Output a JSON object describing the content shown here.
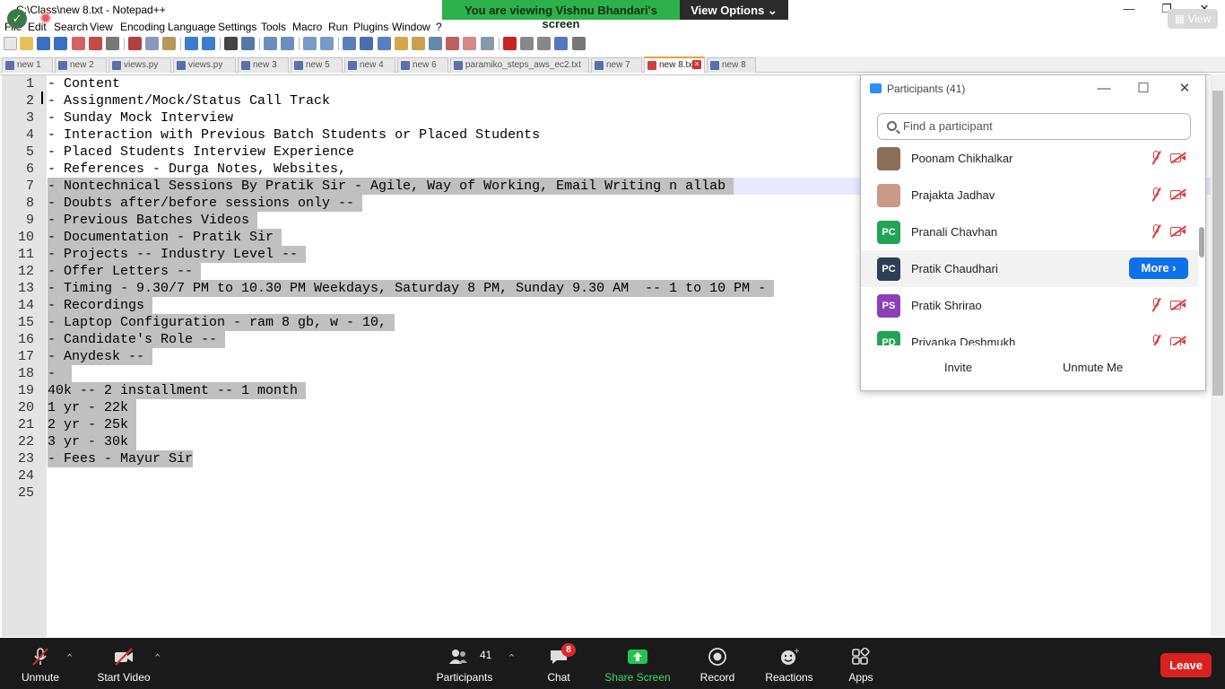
{
  "window": {
    "title": "C:\\Class\\new 8.txt - Notepad++",
    "minimize": "—",
    "restore": "❐",
    "close": "✕"
  },
  "share_banner": {
    "viewing_text": "You are viewing Vishnu Bhandari's screen",
    "view_options": "View Options ⌄"
  },
  "view_pill": "▦ View",
  "menu": [
    "File",
    "Edit",
    "Search",
    "View",
    "Encoding",
    "Language",
    "Settings",
    "Tools",
    "Macro",
    "Run",
    "Plugins",
    "Window",
    "?"
  ],
  "tabs": [
    {
      "label": "new 1"
    },
    {
      "label": "new 2"
    },
    {
      "label": "views.py"
    },
    {
      "label": "views.py"
    },
    {
      "label": "new 3"
    },
    {
      "label": "new 5"
    },
    {
      "label": "new 4"
    },
    {
      "label": "new 6"
    },
    {
      "label": "paramiko_steps_aws_ec2.txt"
    },
    {
      "label": "new 7"
    },
    {
      "label": "new 8.txt",
      "active": true
    },
    {
      "label": "new 8"
    }
  ],
  "editor": {
    "lines": [
      "- Content",
      "- Assignment/Mock/Status Call Track",
      "- Sunday Mock Interview",
      "- Interaction with Previous Batch Students or Placed Students",
      "- Placed Students Interview Experience",
      "- References - Durga Notes, Websites,",
      "- Nontechnical Sessions By Pratik Sir - Agile, Way of Working, Email Writing n allab ",
      "- Doubts after/before sessions only -- ",
      "- Previous Batches Videos ",
      "- Documentation - Pratik Sir ",
      "- Projects -- Industry Level -- ",
      "- Offer Letters -- ",
      "- Timing - 9.30/7 PM to 10.30 PM Weekdays, Saturday 8 PM, Sunday 9.30 AM  -- 1 to 10 PM - ",
      "- Recordings ",
      "- Laptop Configuration - ram 8 gb, w - 10, ",
      "- Candidate's Role -- ",
      "- Anydesk -- ",
      "-  ",
      "40k -- 2 installment -- 1 month ",
      "1 yr - 22k ",
      "2 yr - 25k ",
      "3 yr - 30k ",
      "- Fees - Mayur Sir",
      "",
      ""
    ],
    "line_numbers": [
      "1",
      "2",
      "3",
      "4",
      "5",
      "6",
      "7",
      "8",
      "9",
      "10",
      "11",
      "12",
      "13",
      "14",
      "15",
      "16",
      "17",
      "18",
      "19",
      "20",
      "21",
      "22",
      "23",
      "24",
      "25"
    ]
  },
  "participants_panel": {
    "title": "Participants (41)",
    "search_placeholder": "Find a participant",
    "participants": [
      {
        "name": "Poonam Chikhalkar",
        "initials": "",
        "avatar_color": "#8a6e5a",
        "muted": true,
        "video_off": true
      },
      {
        "name": "Prajakta Jadhav",
        "initials": "",
        "avatar_color": "#c99a88",
        "muted": true,
        "video_off": true
      },
      {
        "name": "Pranali Chavhan",
        "initials": "PC",
        "avatar_color": "#23a455",
        "muted": true,
        "video_off": true
      },
      {
        "name": "Pratik Chaudhari",
        "initials": "PC",
        "avatar_color": "#2e3e55",
        "highlighted": true,
        "more_label": "More ›"
      },
      {
        "name": "Pratik Shrirao",
        "initials": "PS",
        "avatar_color": "#8b3fb8",
        "muted": true,
        "video_off": true
      },
      {
        "name": "Priyanka Deshmukh",
        "initials": "PD",
        "avatar_color": "#23a455",
        "muted": true,
        "video_off": true
      }
    ],
    "invite_label": "Invite",
    "unmute_me_label": "Unmute Me"
  },
  "zoom_bar": {
    "unmute_label": "Unmute",
    "start_video_label": "Start Video",
    "participants_label": "Participants",
    "participants_count": "41",
    "chat_label": "Chat",
    "chat_badge": "8",
    "share_screen_label": "Share Screen",
    "record_label": "Record",
    "reactions_label": "Reactions",
    "apps_label": "Apps",
    "leave_label": "Leave"
  }
}
